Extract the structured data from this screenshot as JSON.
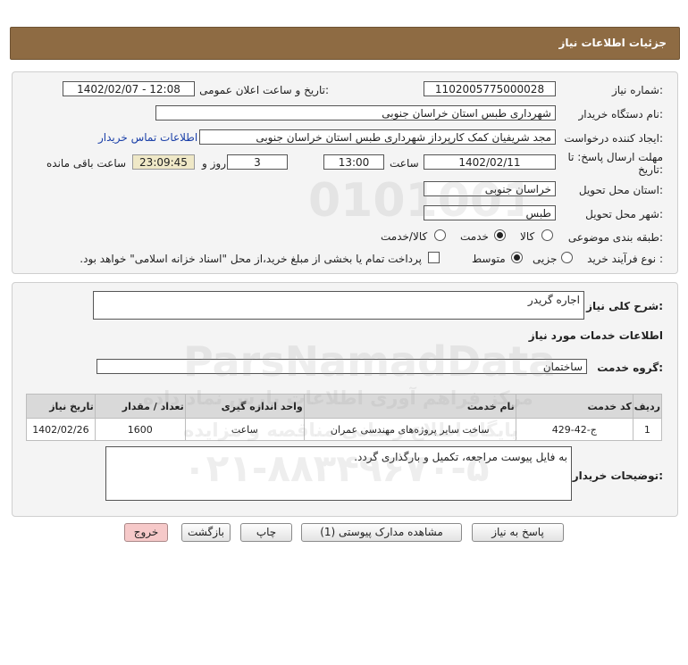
{
  "header": {
    "title": "جزئیات اطلاعات نیاز"
  },
  "form": {
    "need_number_label": "شماره نیاز:",
    "need_number": "1102005775000028",
    "announce_label": "تاریخ و ساعت اعلان عمومی:",
    "announce_value": "1402/02/07 - 12:08",
    "buyer_org_label": "نام دستگاه خریدار:",
    "buyer_org": "شهرداری طبس استان خراسان جنوبی",
    "creator_label": "ایجاد کننده درخواست:",
    "creator": "مجد شریفیان کمک کارپرداز شهرداری طبس استان خراسان جنوبی",
    "contact_link": "اطلاعات تماس خریدار",
    "deadline_label_1": "مهلت ارسال پاسخ: تا",
    "deadline_label_2": "تاریخ:",
    "deadline_date": "1402/02/11",
    "time_label": "ساعت",
    "deadline_time": "13:00",
    "days_value": "3",
    "days_label": "روز و",
    "remaining_time": "23:09:45",
    "remaining_label": "ساعت باقی مانده",
    "province_label": "استان محل تحویل:",
    "province": "خراسان جنوبی",
    "city_label": "شهر محل تحویل:",
    "city": "طبس",
    "category_label": "طبقه بندی موضوعی:",
    "category_options": [
      "کالا",
      "خدمت",
      "کالا/خدمت"
    ],
    "category_selected": "خدمت",
    "process_label": "نوع فرآیند خرید :",
    "process_options": [
      "جزیی",
      "متوسط"
    ],
    "process_selected": "متوسط",
    "treasury_note": "پرداخت تمام یا بخشی از مبلغ خرید،از محل \"اسناد خزانه اسلامی\" خواهد بود."
  },
  "details": {
    "summary_label": "شرح کلی نیاز:",
    "summary": "اجاره گریدر",
    "services_heading": "اطلاعات خدمات مورد نیاز",
    "service_group_label": "گروه خدمت:",
    "service_group": "ساختمان",
    "table": {
      "headers": [
        "ردیف",
        "کد خدمت",
        "نام خدمت",
        "واحد اندازه گیری",
        "تعداد / مقدار",
        "تاریخ نیاز"
      ],
      "rows": [
        [
          "1",
          "ج-42-429",
          "ساخت سایر پروژه‌های مهندسی عمران",
          "ساعت",
          "1600",
          "1402/02/26"
        ]
      ]
    },
    "buyer_notes_label": "توضیحات خریدار:",
    "buyer_notes": "به فایل پیوست مراجعه، تکمیل و بارگذاری گردد."
  },
  "buttons": {
    "reply": "پاسخ به نیاز",
    "attachments": "مشاهده مدارک پیوستی (1)",
    "print": "چاپ",
    "back": "بازگشت",
    "exit": "خروج"
  },
  "watermark": {
    "brand": "ParsNamadData",
    "digits": "0101001",
    "line1": "مرکز فراهم آوری اطلاعات پارس نماد داده",
    "line2": "پایگاه اطلاع رسانی مناقصه و مزایده",
    "phone": "۰۲۱-۸۸۳۴۹۶۷۰-۵"
  },
  "colors": {
    "header_bg": "#8e6b43",
    "link": "#1a3fa8",
    "exit_button": "#f6c9c9"
  }
}
